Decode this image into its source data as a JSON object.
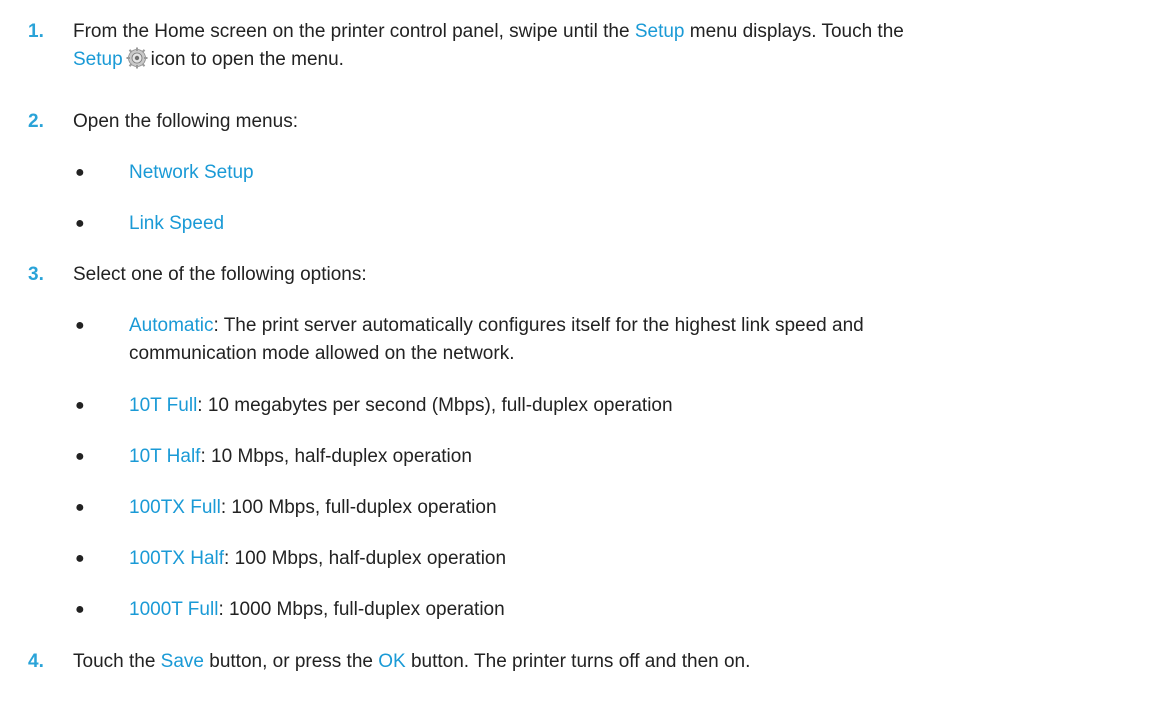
{
  "steps": [
    {
      "number": "1.",
      "line1_a": "From the Home screen on the printer control panel, swipe until the ",
      "line1_link": "Setup",
      "line1_b": " menu displays. Touch the",
      "line2_link": "Setup",
      "line2_icon": "gear-icon",
      "line2_b": "icon to open the menu."
    },
    {
      "number": "2.",
      "text": "Open the following menus:",
      "bullets": [
        "Network Setup",
        "Link Speed"
      ]
    },
    {
      "number": "3.",
      "text": "Select one of the following options:",
      "options": [
        {
          "name": "Automatic",
          "desc_line1": ": The print server automatically configures itself for the highest link speed and",
          "desc_line2": "communication mode allowed on the network."
        },
        {
          "name": "10T Full",
          "desc": ": 10 megabytes per second (Mbps), full-duplex operation"
        },
        {
          "name": "10T Half",
          "desc": ": 10 Mbps, half-duplex operation"
        },
        {
          "name": "100TX Full",
          "desc": ": 100 Mbps, full-duplex operation"
        },
        {
          "name": "100TX Half",
          "desc": ": 100 Mbps, half-duplex operation"
        },
        {
          "name": "1000T Full",
          "desc": ": 1000 Mbps, full-duplex operation"
        }
      ]
    },
    {
      "number": "4.",
      "text_a": "Touch the ",
      "link1": "Save",
      "text_b": " button, or press the ",
      "link2": "OK",
      "text_c": " button. The printer turns off and then on."
    }
  ],
  "bullet_glyph": "●",
  "colors": {
    "link": "#1a9ad6",
    "step_number": "#2aa3d8",
    "text": "#222222"
  }
}
